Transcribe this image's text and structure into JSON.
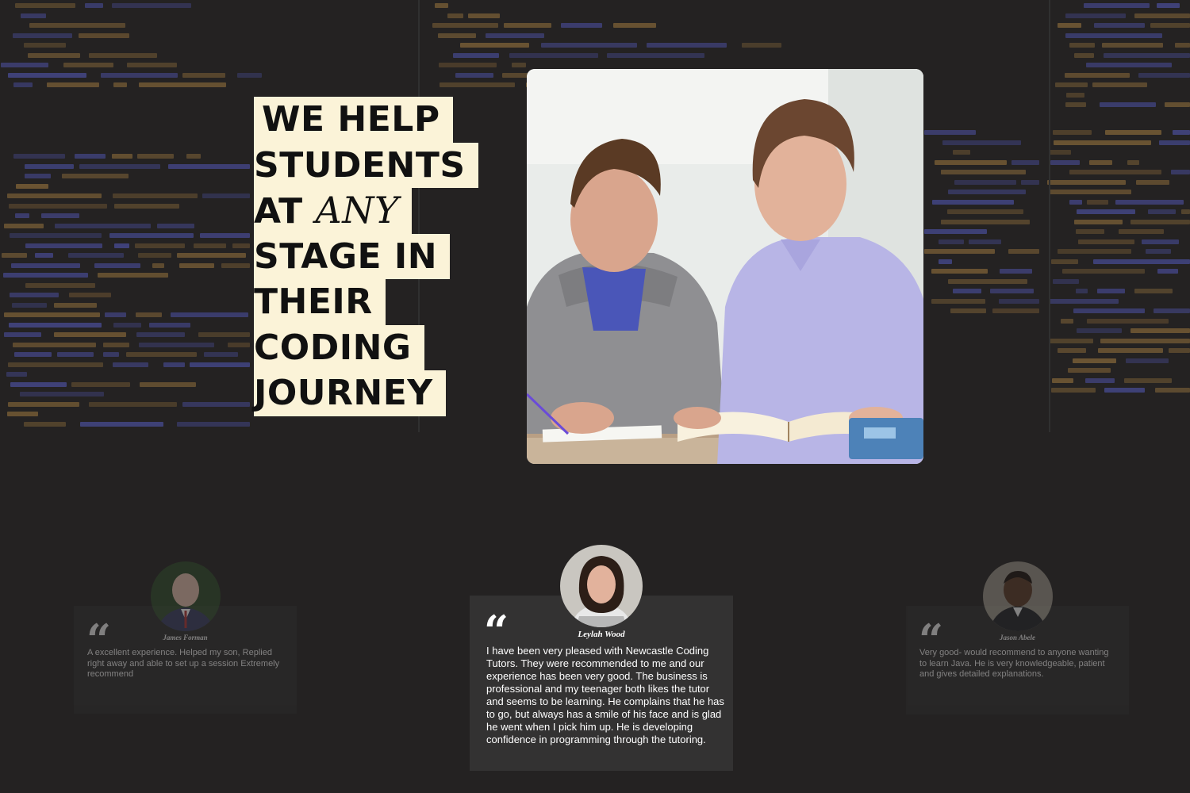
{
  "hero": {
    "line1": "WE HELP",
    "line2": "STUDENTS",
    "line3_prefix": "AT ",
    "line3_italic": "ANY",
    "line4": "STAGE IN",
    "line5": "THEIR",
    "line6": "CODING",
    "line7": "JOURNEY",
    "image": "tutor-and-student-studying-photo"
  },
  "testimonials": [
    {
      "name": "James Forman",
      "text": "A excellent experience. Helped my son, Replied right away and able to set up a session Extremely recommend",
      "state": "faded"
    },
    {
      "name": "Leylah Wood",
      "text": "I have been very pleased with Newcastle Coding Tutors. They were recommended to me and our experience has been very good. The business is professional and my teenager both likes the tutor and seems to be learning. He complains that he has to go, but always has a smile of his face and is glad he went when I pick him up. He is developing confidence in programming through the tutoring.",
      "state": "active"
    },
    {
      "name": "Jason Abele",
      "text": "Very good- would recommend to anyone wanting to learn Java. He is very knowledgeable, patient and gives detailed explanations.",
      "state": "faded"
    }
  ],
  "quote_glyph": "“",
  "colors": {
    "background": "#242222",
    "highlight": "#fbf3d8",
    "card": "#2e2e2e",
    "code_orange": "#8a6a3a",
    "code_blue": "#4b4f9e"
  }
}
